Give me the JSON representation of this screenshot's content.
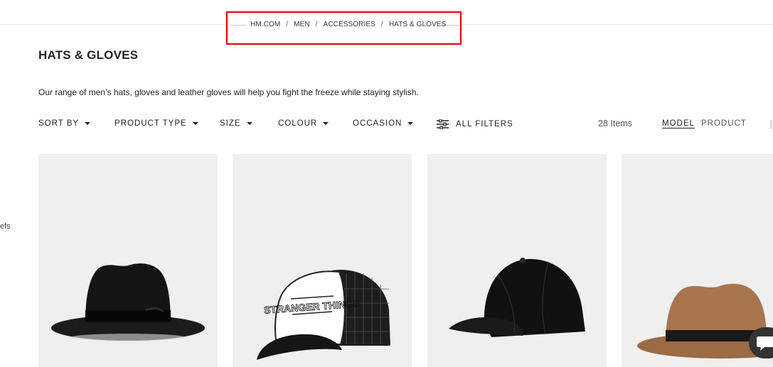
{
  "breadcrumb": {
    "items": [
      "HM.COM",
      "MEN",
      "ACCESSORIES",
      "HATS & GLOVES"
    ],
    "separator": "/"
  },
  "page": {
    "title": "HATS & GLOVES",
    "description": "Our range of men’s hats, gloves and leather gloves will help you fight the freeze while staying stylish."
  },
  "filters": {
    "sort_by": "SORT BY",
    "product_type": "PRODUCT TYPE",
    "size": "SIZE",
    "colour": "COLOUR",
    "occasion": "OCCASION",
    "all_filters": "ALL FILTERS"
  },
  "results": {
    "items_count": "28 Items",
    "view_model": "MODEL",
    "view_product": "PRODUCT"
  },
  "sidebar": {
    "partial_text": "efs"
  },
  "products": [
    {
      "icon": "black-fedora-hat-image"
    },
    {
      "icon": "stranger-things-trucker-cap-image",
      "print": "STRANGER THINGS"
    },
    {
      "icon": "black-baseball-cap-image"
    },
    {
      "icon": "brown-fedora-hat-image"
    }
  ],
  "colors": {
    "highlight_border": "#e00000",
    "card_background": "#efefef",
    "text": "#222222"
  },
  "chat": {
    "icon": "chat-bubble-icon"
  }
}
